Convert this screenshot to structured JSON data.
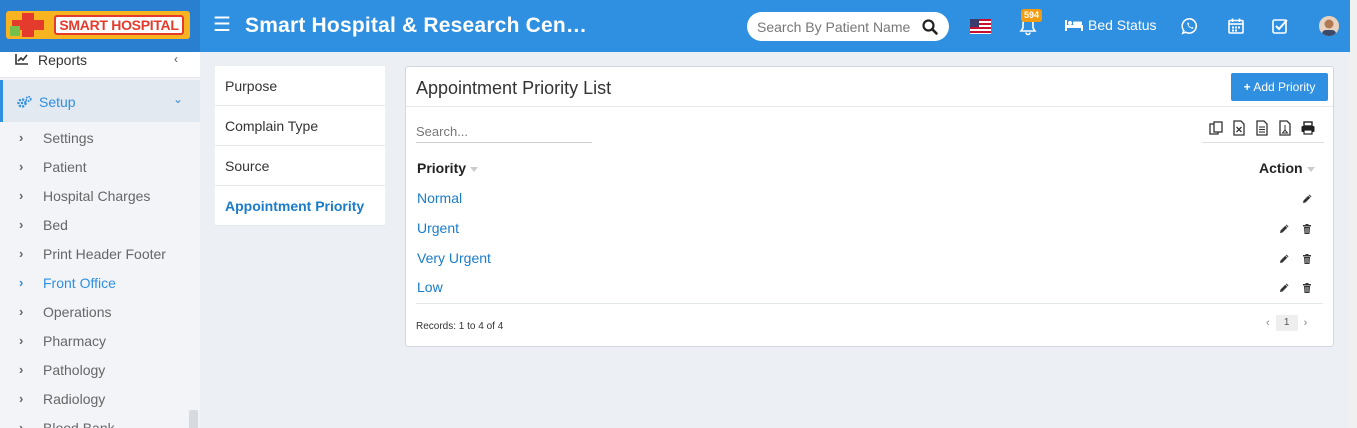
{
  "header": {
    "logo_text": "SMART HOSPITAL",
    "menu_icon": "☰",
    "app_title": "Smart Hospital & Research Cen…",
    "search_placeholder": "Search By Patient Name",
    "notification_count": "594",
    "bed_status_label": "Bed Status"
  },
  "sidebar": {
    "reports_label": "Reports",
    "setup_label": "Setup",
    "items": [
      {
        "label": "Settings"
      },
      {
        "label": "Patient"
      },
      {
        "label": "Hospital Charges"
      },
      {
        "label": "Bed"
      },
      {
        "label": "Print Header Footer"
      },
      {
        "label": "Front Office",
        "active": true
      },
      {
        "label": "Operations"
      },
      {
        "label": "Pharmacy"
      },
      {
        "label": "Pathology"
      },
      {
        "label": "Radiology"
      },
      {
        "label": "Blood Bank"
      }
    ]
  },
  "submenu": {
    "items": [
      {
        "label": "Purpose"
      },
      {
        "label": "Complain Type"
      },
      {
        "label": "Source"
      },
      {
        "label": "Appointment Priority",
        "active": true
      }
    ]
  },
  "panel": {
    "title": "Appointment Priority List",
    "add_button": "Add Priority",
    "search_placeholder": "Search...",
    "columns": [
      "Priority",
      "Action"
    ],
    "rows": [
      {
        "priority": "Normal",
        "actions": [
          "edit"
        ]
      },
      {
        "priority": "Urgent",
        "actions": [
          "edit",
          "delete"
        ]
      },
      {
        "priority": "Very Urgent",
        "actions": [
          "edit",
          "delete"
        ]
      },
      {
        "priority": "Low",
        "actions": [
          "edit",
          "delete"
        ]
      }
    ],
    "records_text": "Records: 1 to 4 of 4",
    "pager": {
      "prev": "‹",
      "page": "1",
      "next": "›"
    }
  },
  "icons": {
    "export_tools": [
      "copy-icon",
      "excel-icon",
      "csv-icon",
      "pdf-icon",
      "print-icon"
    ]
  },
  "colors": {
    "brand_blue": "#2f8fe0",
    "link_blue": "#1a7cc9",
    "badge_orange": "#f39c12"
  }
}
